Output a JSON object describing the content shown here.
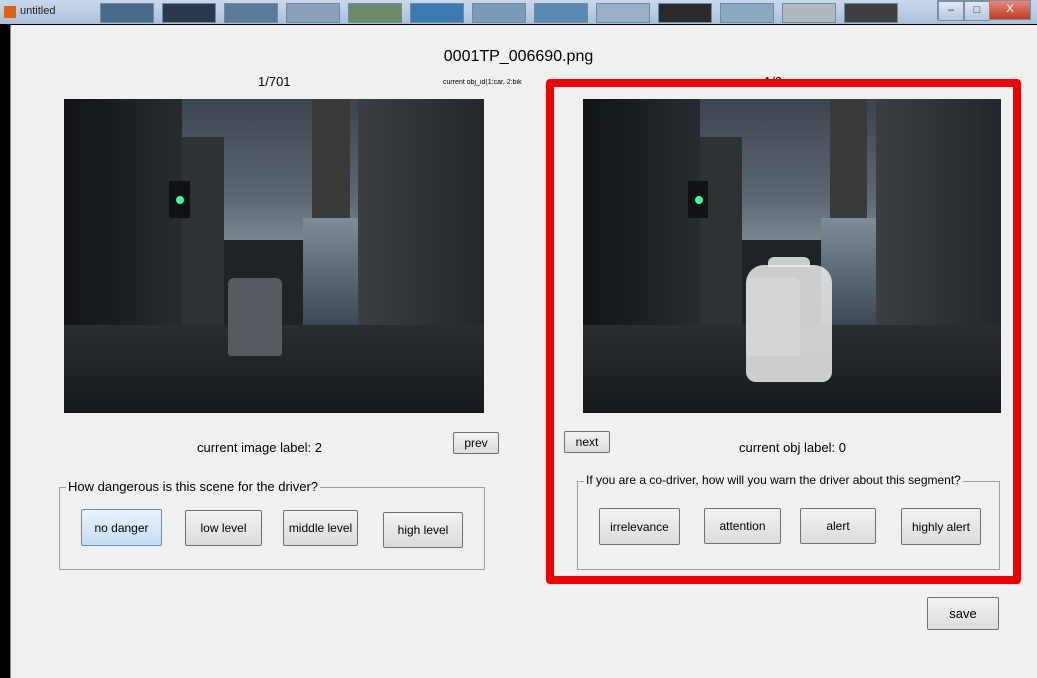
{
  "window": {
    "title": "untitled",
    "close_glyph": "X"
  },
  "header": {
    "filename": "0001TP_006690.png"
  },
  "left": {
    "counter": "1/701",
    "label_text": "current image label: 2",
    "prev_label": "prev",
    "question": "How dangerous is this scene for the driver?",
    "buttons": [
      "no danger",
      "low level",
      "middle level",
      "high level"
    ],
    "selected": "no danger"
  },
  "right": {
    "obj_id_text": "current obj_id(1:car, 2:bik",
    "counter": "1/2",
    "next_label": "next",
    "label_text": "current obj label: 0",
    "question": "If you are a co-driver, how will you warn the driver about this segment?",
    "buttons": [
      "irrelevance",
      "attention",
      "alert",
      "highly alert"
    ]
  },
  "footer": {
    "save_label": "save"
  },
  "colors": {
    "highlight": "#f20000",
    "background": "#f0f0f0",
    "selected_button": "#c4dff6"
  }
}
